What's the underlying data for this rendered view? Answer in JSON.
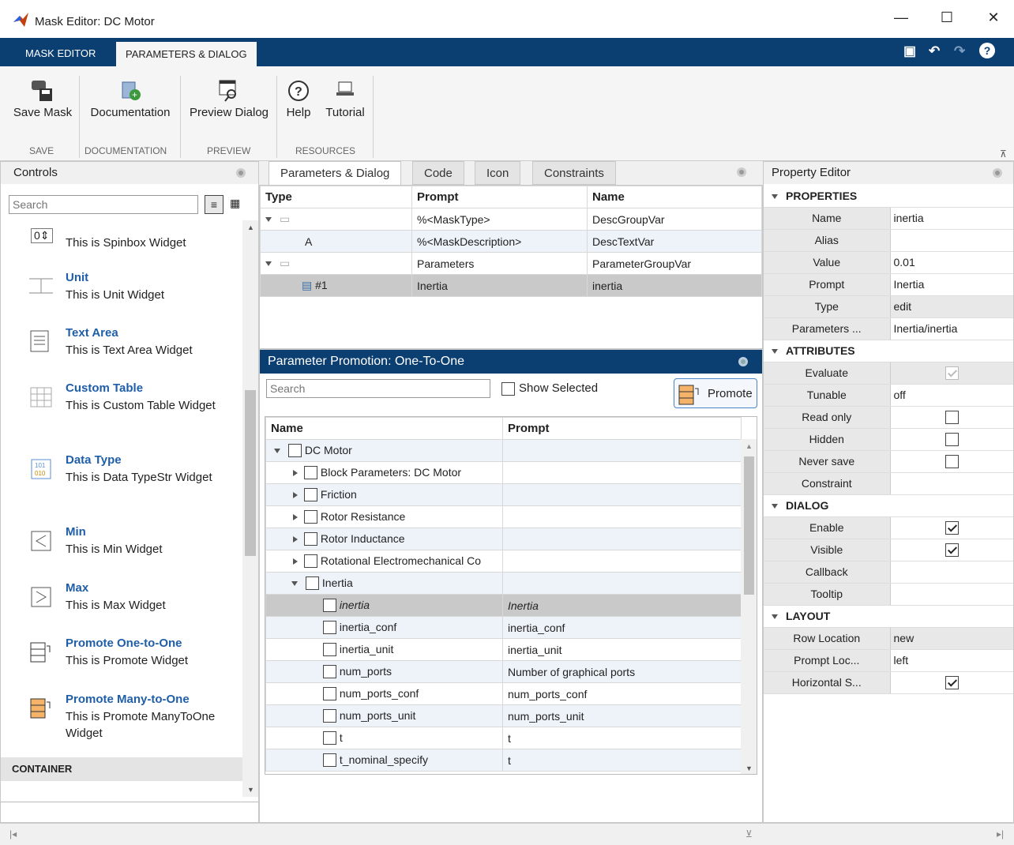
{
  "window": {
    "title": "Mask Editor: DC Motor",
    "min": "—",
    "max": "☐",
    "close": "✕"
  },
  "ribbon_tabs": [
    "MASK EDITOR",
    "PARAMETERS & DIALOG"
  ],
  "ribbon": {
    "save_label": "Save Mask",
    "doc_label": "Documentation",
    "preview_label": "Preview Dialog",
    "help_label": "Help",
    "tutorial_label": "Tutorial",
    "sections": [
      "SAVE",
      "DOCUMENTATION",
      "PREVIEW",
      "RESOURCES"
    ]
  },
  "controls": {
    "title": "Controls",
    "search_placeholder": "Search",
    "items": [
      {
        "title": "",
        "desc": "This is Spinbox Widget"
      },
      {
        "title": "Unit",
        "desc": "This is Unit Widget"
      },
      {
        "title": "Text Area",
        "desc": "This is Text Area Widget"
      },
      {
        "title": "Custom Table",
        "desc": "This is Custom Table Widget"
      },
      {
        "title": "Data Type",
        "desc": "This is Data TypeStr Widget"
      },
      {
        "title": "Min",
        "desc": "This is Min Widget"
      },
      {
        "title": "Max",
        "desc": "This is Max Widget"
      },
      {
        "title": "Promote One-to-One",
        "desc": "This is Promote Widget"
      },
      {
        "title": "Promote Many-to-One",
        "desc": "This is Promote ManyToOne Widget"
      }
    ],
    "container_label": "CONTAINER"
  },
  "center_tabs": [
    "Parameters & Dialog",
    "Code",
    "Icon",
    "Constraints"
  ],
  "param_table": {
    "headers": [
      "Type",
      "Prompt",
      "Name"
    ],
    "rows": [
      {
        "type": "",
        "prompt": "%<MaskType>",
        "name": "DescGroupVar"
      },
      {
        "type": "A",
        "prompt": "%<MaskDescription>",
        "name": "DescTextVar"
      },
      {
        "type": "",
        "prompt": "Parameters",
        "name": "ParameterGroupVar"
      },
      {
        "type": "#1",
        "prompt": "Inertia",
        "name": "inertia"
      }
    ]
  },
  "promotion": {
    "title": "Parameter Promotion: One-To-One",
    "search_placeholder": "Search",
    "show_selected": "Show Selected",
    "promote_label": "Promote",
    "headers": [
      "Name",
      "Prompt"
    ],
    "rows": [
      {
        "name": "DC Motor",
        "prompt": ""
      },
      {
        "name": "Block Parameters: DC Motor",
        "prompt": ""
      },
      {
        "name": "Friction",
        "prompt": ""
      },
      {
        "name": "Rotor Resistance",
        "prompt": ""
      },
      {
        "name": "Rotor Inductance",
        "prompt": ""
      },
      {
        "name": "Rotational Electromechanical Co",
        "prompt": ""
      },
      {
        "name": "Inertia",
        "prompt": ""
      },
      {
        "name": "inertia",
        "prompt": "Inertia"
      },
      {
        "name": "inertia_conf",
        "prompt": "inertia_conf"
      },
      {
        "name": "inertia_unit",
        "prompt": "inertia_unit"
      },
      {
        "name": "num_ports",
        "prompt": "Number of graphical ports"
      },
      {
        "name": "num_ports_conf",
        "prompt": "num_ports_conf"
      },
      {
        "name": "num_ports_unit",
        "prompt": "num_ports_unit"
      },
      {
        "name": "t",
        "prompt": "t"
      },
      {
        "name": "t_nominal_specify",
        "prompt": "t"
      }
    ]
  },
  "property_editor": {
    "title": "Property Editor",
    "sections": {
      "properties": "PROPERTIES",
      "attributes": "ATTRIBUTES",
      "dialog": "DIALOG",
      "layout": "LAYOUT"
    },
    "props": [
      {
        "k": "Name",
        "v": "inertia"
      },
      {
        "k": "Alias",
        "v": ""
      },
      {
        "k": "Value",
        "v": "0.01"
      },
      {
        "k": "Prompt",
        "v": "Inertia"
      },
      {
        "k": "Type",
        "v": "edit"
      },
      {
        "k": "Parameters ...",
        "v": "Inertia/inertia"
      }
    ],
    "attrs": [
      {
        "k": "Evaluate",
        "check": "disabled-on"
      },
      {
        "k": "Tunable",
        "v": "off"
      },
      {
        "k": "Read only",
        "check": "off"
      },
      {
        "k": "Hidden",
        "check": "off"
      },
      {
        "k": "Never save",
        "check": "off"
      },
      {
        "k": "Constraint",
        "v": ""
      }
    ],
    "dialog": [
      {
        "k": "Enable",
        "check": "on"
      },
      {
        "k": "Visible",
        "check": "on"
      },
      {
        "k": "Callback",
        "v": ""
      },
      {
        "k": "Tooltip",
        "v": ""
      }
    ],
    "layout": [
      {
        "k": "Row Location",
        "v": "new"
      },
      {
        "k": "Prompt Loc...",
        "v": "left"
      },
      {
        "k": "Horizontal S...",
        "check": "on"
      }
    ]
  }
}
